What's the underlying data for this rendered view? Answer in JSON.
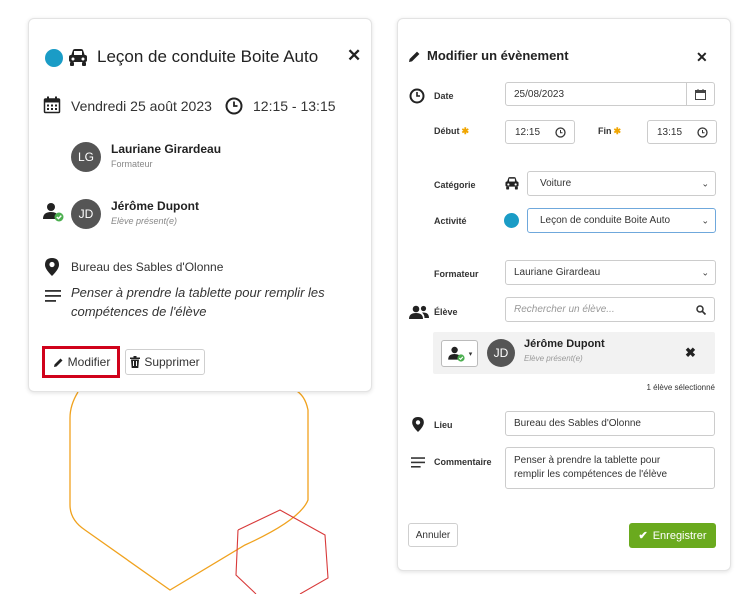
{
  "event": {
    "title": "Leçon de conduite Boite Auto",
    "category_color": "#1a9cc6",
    "date": "Vendredi 25 août 2023",
    "time": "12:15 - 13:15",
    "trainer": {
      "initials": "LG",
      "name": "Lauriane Girardeau",
      "role": "Formateur"
    },
    "student": {
      "initials": "JD",
      "name": "Jérôme Dupont",
      "status": "Elève présent(e)"
    },
    "location": "Bureau des Sables d'Olonne",
    "comment_line1": "Penser à prendre la tablette pour remplir les",
    "comment_line2": "compétences de l'élève",
    "modify_label": "Modifier",
    "delete_label": "Supprimer",
    "highlight_color": "#d0021b"
  },
  "edit": {
    "title": "Modifier un évènement",
    "date_label": "Date",
    "date_value": "25/08/2023",
    "start_label": "Début",
    "start_value": "12:15",
    "end_label": "Fin",
    "end_value": "13:15",
    "category_label": "Catégorie",
    "category_value": "Voiture",
    "activity_label": "Activité",
    "activity_value": "Leçon de conduite Boite Auto",
    "trainer_label": "Formateur",
    "trainer_value": "Lauriane Girardeau",
    "student_label": "Élève",
    "student_placeholder": "Rechercher un élève...",
    "student_initials": "JD",
    "student_name": "Jérôme Dupont",
    "student_status": "Elève présent(e)",
    "selected_count": "1 élève sélectionné",
    "location_label": "Lieu",
    "location_value": "Bureau des Sables d'Olonne",
    "comment_label": "Commentaire",
    "comment_line1": "Penser à prendre la tablette pour",
    "comment_line2": "remplir les compétences de l'élève",
    "cancel_label": "Annuler",
    "save_label": "Enregistrer",
    "save_color": "#6aaa1e"
  }
}
